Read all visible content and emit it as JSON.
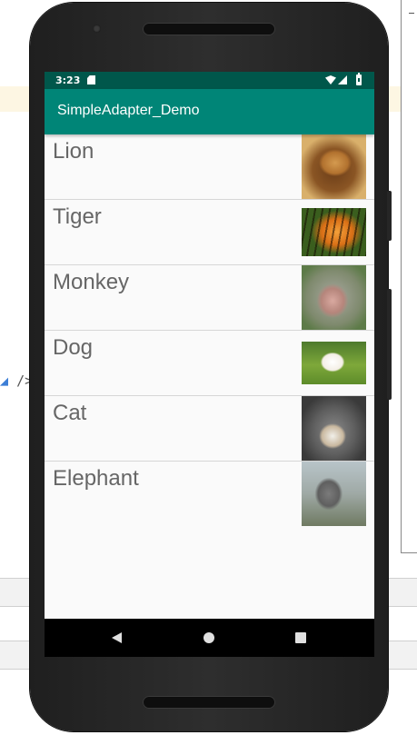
{
  "ide": {
    "code_fragment": "/>"
  },
  "status_bar": {
    "time": "3:23",
    "icons": [
      "sd-card-icon",
      "wifi-icon",
      "signal-icon",
      "battery-icon"
    ]
  },
  "app_bar": {
    "title": "SimpleAdapter_Demo",
    "color": "#008577",
    "status_color": "#00574b"
  },
  "list": {
    "items": [
      {
        "label": "Lion",
        "image": "lion-image"
      },
      {
        "label": "Tiger",
        "image": "tiger-image"
      },
      {
        "label": "Monkey",
        "image": "monkey-image"
      },
      {
        "label": "Dog",
        "image": "dog-image"
      },
      {
        "label": "Cat",
        "image": "cat-image"
      },
      {
        "label": "Elephant",
        "image": "elephant-image"
      }
    ]
  },
  "nav_bar": {
    "icons": [
      "back-icon",
      "home-icon",
      "recents-icon"
    ]
  }
}
